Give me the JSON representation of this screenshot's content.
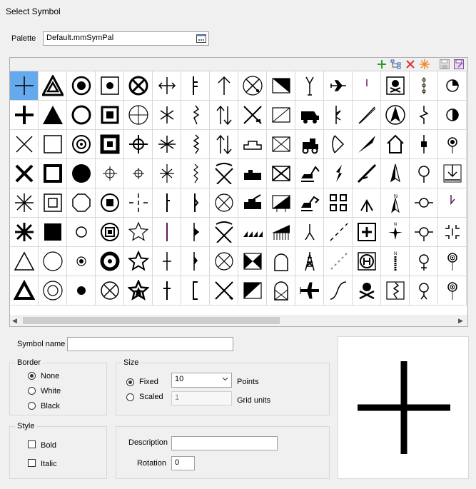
{
  "dialog": {
    "title": "Select Symbol"
  },
  "palette": {
    "label": "Palette",
    "value": "Default.mmSymPal",
    "browse_icon": "ellipsis-browse-icon"
  },
  "toolbar": {
    "icons": [
      "add-icon",
      "tree-icon",
      "delete-icon",
      "new-symbol-icon",
      "save-icon",
      "save-as-icon"
    ],
    "colors": {
      "add": "#2a9d2a",
      "delete": "#e03030",
      "new": "#f08a24"
    }
  },
  "grid": {
    "selected": "plus-thin",
    "rows": [
      [
        "plus-thin",
        "triangle-double",
        "circle-dot-ring",
        "square-dot",
        "circle-x",
        "arrows-lr",
        "bar-ticks",
        "arrow-up",
        "compass-x",
        "triangle-flag",
        "y-fork",
        "plane-small",
        "tick",
        "skull-box",
        "dots-vertical",
        "pie-quarter"
      ],
      [
        "plus-bold",
        "triangle-filled",
        "circle-open",
        "square-dot-bold",
        "circle-cross",
        "asterisk6",
        "zigzag-v",
        "arrows-updown",
        "pickaxes",
        "rect-diag",
        "truck",
        "flag-n",
        "diag-line",
        "arrow-compass",
        "break-v",
        "half-circle"
      ],
      [
        "x-thin",
        "square-open",
        "circle-ring-dot",
        "square-ring",
        "crosshair",
        "asterisk-bold",
        "zigzag-v2",
        "arrows-updown2",
        "mine-shape",
        "rect-x",
        "tractor",
        "bracket-arc",
        "diag-filled",
        "house-outline",
        "diamond-line",
        "circle-dot-line"
      ],
      [
        "x-bold",
        "square-thick",
        "circle-filled",
        "target-sm",
        "target-xs",
        "asterisk-v",
        "zigzag-v3",
        "pickaxe",
        "factory",
        "rect-cross",
        "excavator",
        "notch-r",
        "diag-thick",
        "arrow-n",
        "circle-stem",
        "arrow-down-box"
      ],
      [
        "asterisk8",
        "square-inner",
        "octagon",
        "circle-square",
        "dash-cross",
        "bar-v",
        "bar-tick-r",
        "circle-x-thin",
        "tank",
        "flag-tri",
        "loader",
        "four-squares",
        "chevrons-up",
        "north-arrow",
        "line-circle",
        "tick-r"
      ],
      [
        "asterisk8-bold",
        "square-filled",
        "circle-sm",
        "circle-square2",
        "star-open",
        "line-v",
        "flag-r",
        "pick-cross",
        "triangles-row",
        "comb-flag",
        "fork-down",
        "dash-diag",
        "plus-box",
        "compass-n",
        "line-circle2",
        "dash-corners"
      ],
      [
        "triangle-open",
        "circle-large",
        "circle-dot-sm",
        "circle-ring-bold",
        "star-open2",
        "plus-v",
        "flag-half",
        "circle-x2",
        "hourglass",
        "arch",
        "tower",
        "dot-diag",
        "h-circle",
        "compass-n2",
        "venus-small",
        "circle-dot-stem"
      ],
      [
        "triangle-thick",
        "circle-double",
        "dot-filled",
        "circle-x3",
        "star-filled",
        "cross-v",
        "bracket-l",
        "pickaxe2",
        "box-diag",
        "gate-x",
        "plane",
        "s-curve",
        "skull-box2",
        "zigzag-box",
        "venus-a",
        "circle-dot-stem2"
      ]
    ]
  },
  "symbol_name": {
    "label": "Symbol name",
    "value": ""
  },
  "border": {
    "title": "Border",
    "options": [
      "None",
      "White",
      "Black"
    ],
    "selected": "None"
  },
  "size": {
    "title": "Size",
    "fixed_label": "Fixed",
    "fixed_value": "10",
    "fixed_unit": "Points",
    "scaled_label": "Scaled",
    "scaled_value": "1",
    "scaled_unit": "Grid units",
    "selected": "Fixed"
  },
  "style": {
    "title": "Style",
    "bold_label": "Bold",
    "italic_label": "Italic",
    "bold": false,
    "italic": false
  },
  "description": {
    "label": "Description",
    "value": ""
  },
  "rotation": {
    "label": "Rotation",
    "value": "0"
  },
  "preview": {
    "symbol": "plus-thin"
  }
}
